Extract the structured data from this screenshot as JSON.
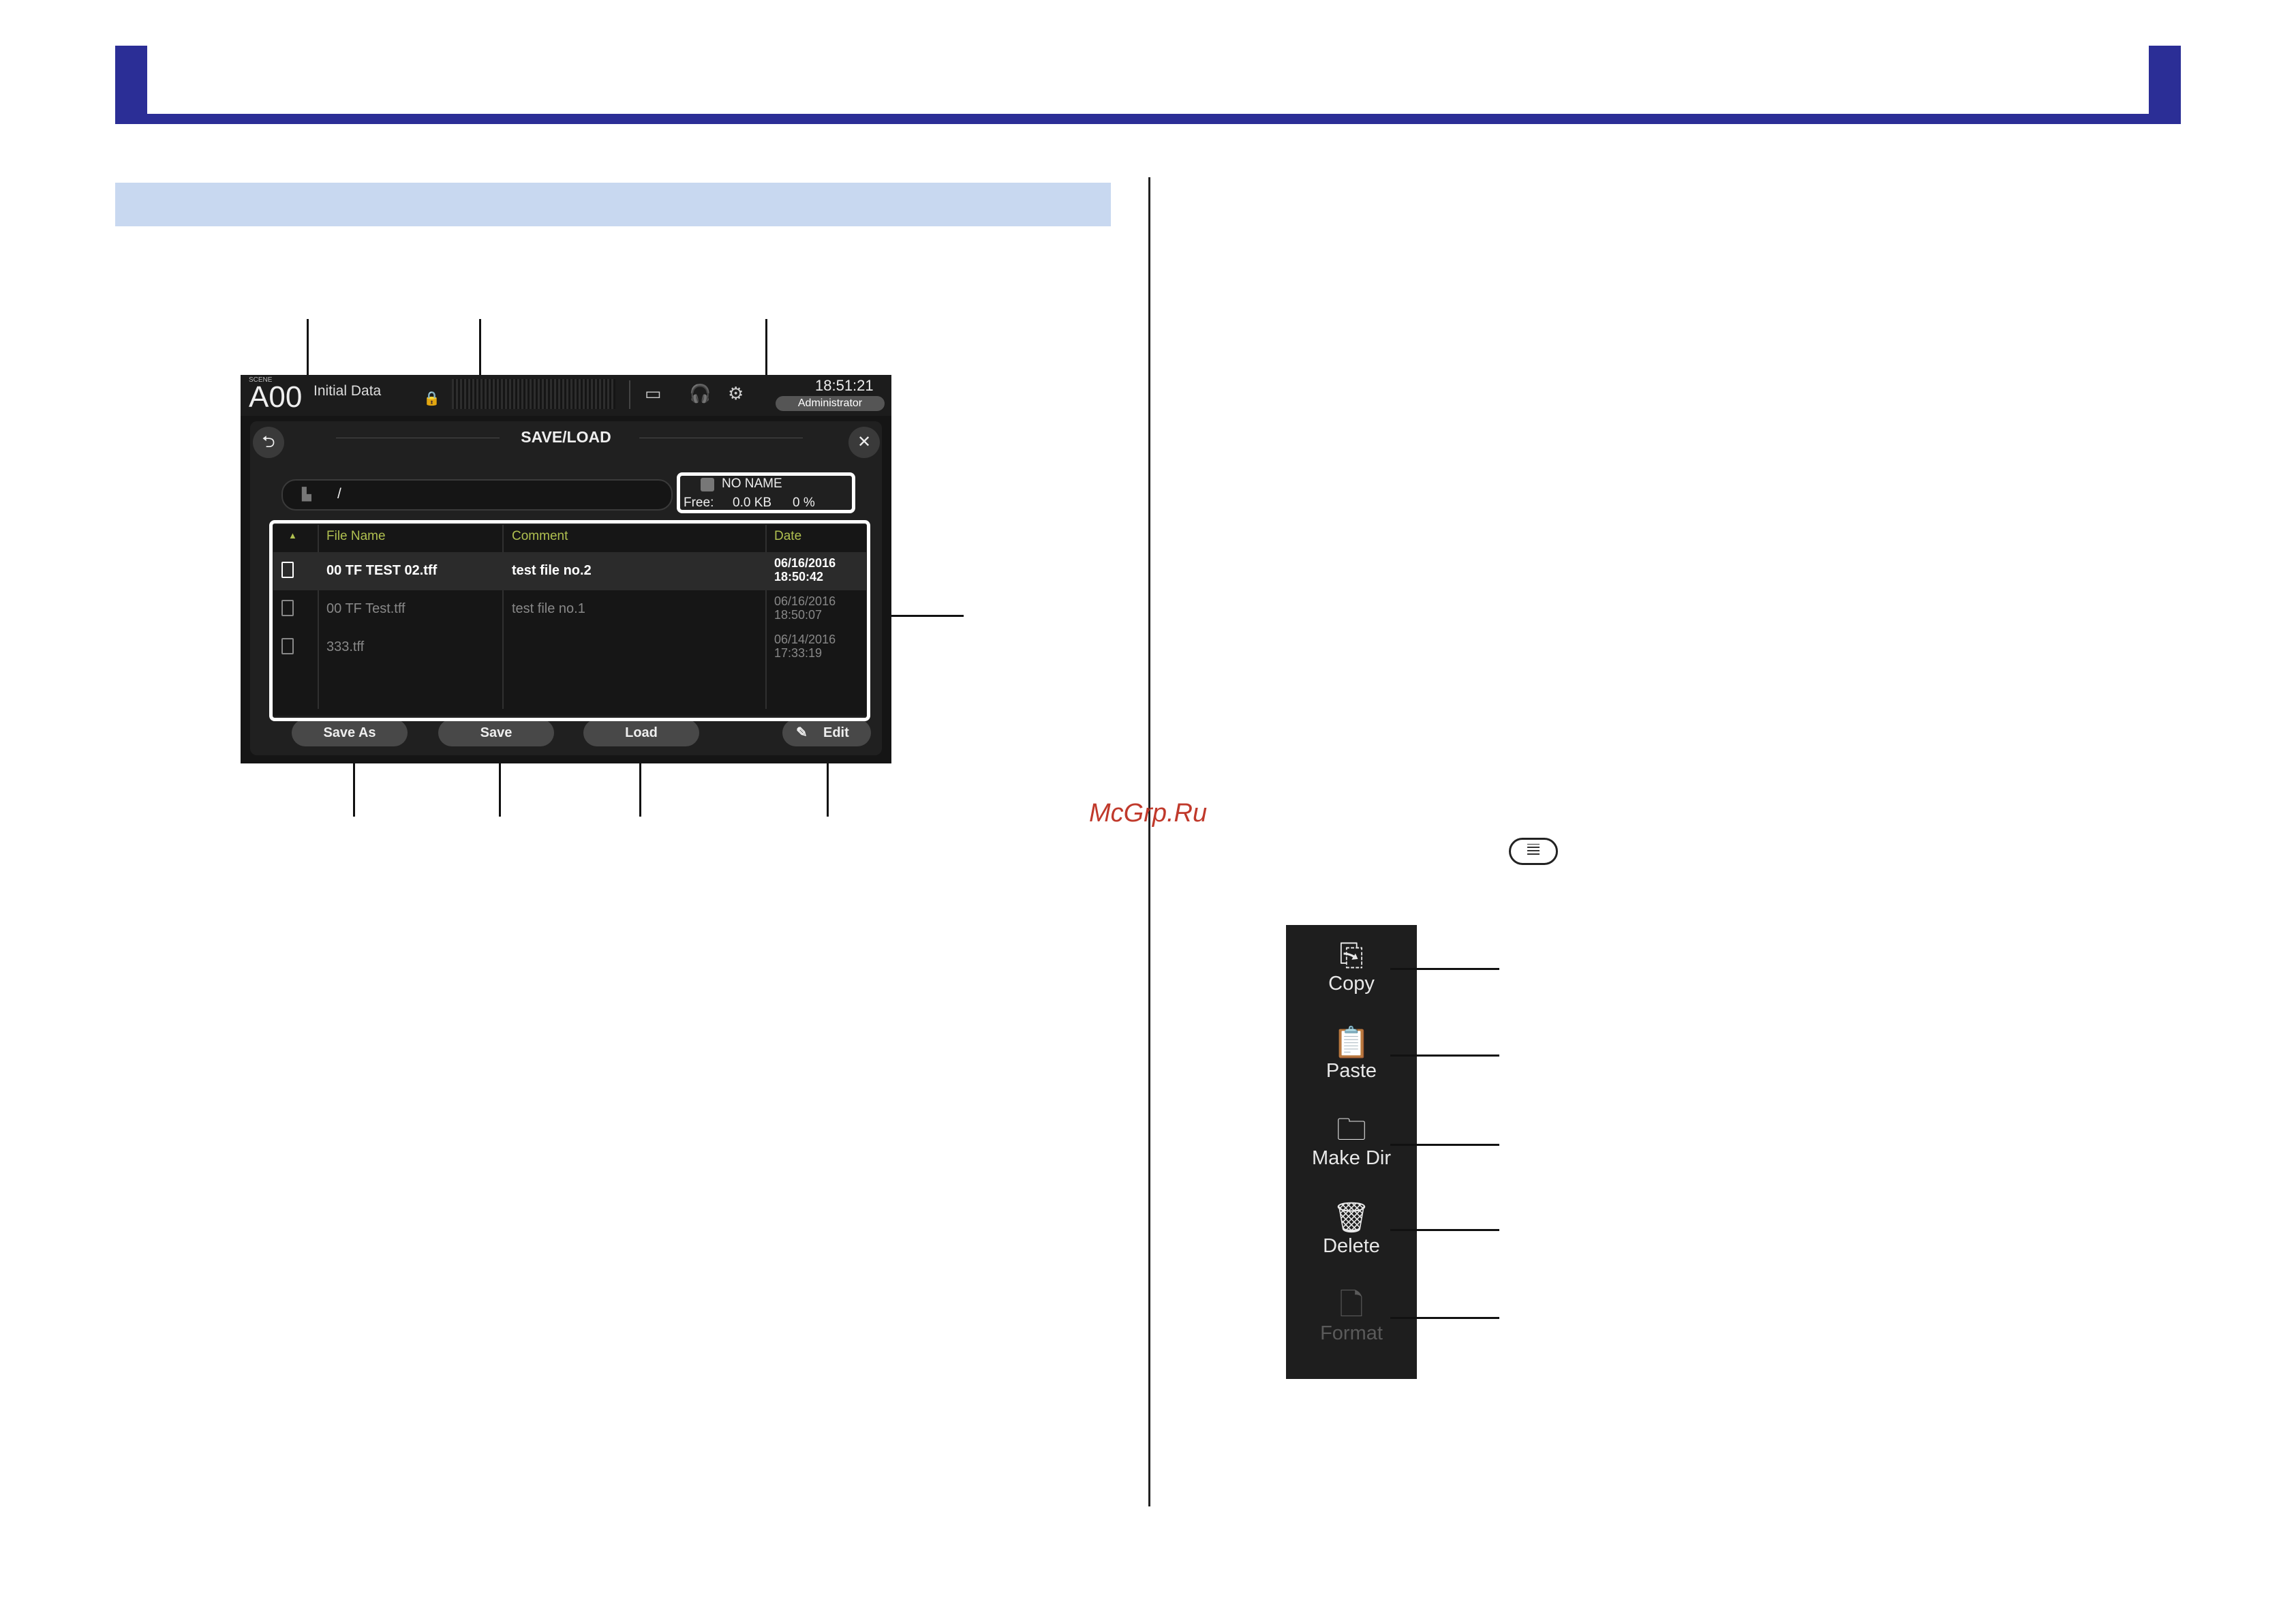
{
  "screen": {
    "scene_label": "SCENE",
    "scene_number": "A00",
    "scene_name": "Initial Data",
    "time": "18:51:21",
    "user": "Administrator",
    "title": "SAVE/LOAD",
    "path": "/",
    "media": {
      "name": "NO NAME",
      "free_label": "Free:",
      "free_size": "0.0 KB",
      "free_percent": "0 %"
    },
    "columns": {
      "sort_icon": "▲",
      "file_name": "File Name",
      "comment": "Comment",
      "date": "Date"
    },
    "files": [
      {
        "name": "00 TF TEST 02.tff",
        "comment": "test file no.2",
        "date": "06/16/2016",
        "time": "18:50:42",
        "selected": true
      },
      {
        "name": "00 TF Test.tff",
        "comment": "test file no.1",
        "date": "06/16/2016",
        "time": "18:50:07",
        "selected": false
      },
      {
        "name": "333.tff",
        "comment": "",
        "date": "06/14/2016",
        "time": "17:33:19",
        "selected": false
      }
    ],
    "buttons": {
      "save_as": "Save As",
      "save": "Save",
      "load": "Load",
      "edit": "Edit"
    }
  },
  "watermark": "McGrp.Ru",
  "menu": {
    "items": [
      {
        "label": "Copy",
        "icon": "copy-icon"
      },
      {
        "label": "Paste",
        "icon": "paste-icon"
      },
      {
        "label": "Make Dir",
        "icon": "make-dir-icon"
      },
      {
        "label": "Delete",
        "icon": "delete-icon"
      },
      {
        "label": "Format",
        "icon": "format-icon",
        "disabled": true
      }
    ]
  },
  "colors": {
    "banner": "#2b2e96",
    "section_bar": "#c8d8f0",
    "column_header": "#b0c050",
    "watermark": "#c0392b"
  }
}
